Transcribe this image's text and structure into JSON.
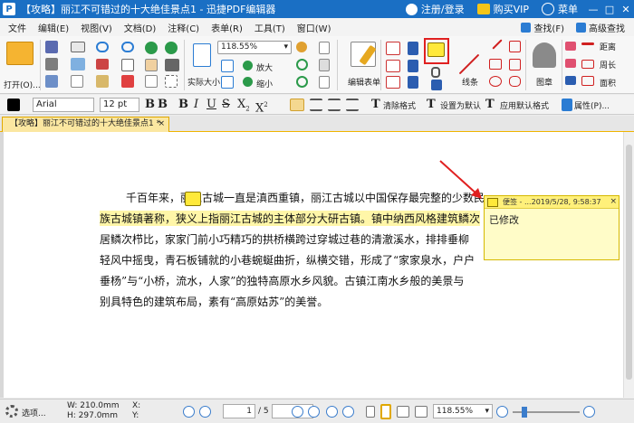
{
  "titlebar": {
    "title": "【攻略】丽江不可错过的十大绝佳景点1 - 迅捷PDF编辑器",
    "login": "注册/登录",
    "vip": "购买VIP",
    "menu": "菜单",
    "min": "—",
    "max": "□",
    "close": "✕"
  },
  "menubar": {
    "items": [
      "文件",
      "编辑(E)",
      "视图(V)",
      "文档(D)",
      "注释(C)",
      "表单(R)",
      "工具(T)",
      "窗口(W)"
    ],
    "find": "查找(F)",
    "advanced_search": "高级查找"
  },
  "ribbon": {
    "open": "打开(O)...",
    "actual_size": "实际大小",
    "zoom": "118.55%",
    "zoom_in": "放大",
    "zoom_out": "缩小",
    "edit_form": "编辑表单",
    "lines": "线条",
    "stamp": "图章",
    "distance": "距离",
    "perimeter": "周长",
    "area": "面积"
  },
  "format": {
    "font": "Arial",
    "size": "12 pt",
    "clear": "清除格式",
    "set_default": "设置为默认",
    "apply_default": "应用默认格式",
    "properties": "属性(P)..."
  },
  "tab": {
    "label": "【攻略】丽江不可错过的十大绝佳景点1 *",
    "close": "×"
  },
  "document": {
    "lines": [
      "千百年来，丽江古城一直是滇西重镇，丽江古城以中国保存最完整的少数民",
      "族古城镇著称，狭义上指丽江古城的主体部分大研古镇。镇中纳西风格建筑鳞次",
      "居鳞次栉比，家家门前小巧精巧的拱桥横跨过穿城过巷的清澈溪水，排排垂柳",
      "轻风中摇曳，青石板铺就的小巷蜿蜒曲折，纵横交错，形成了“家家泉水，户户",
      "垂杨”与“小桥，流水，人家”的独特高原水乡风貌。古镇江南水乡般的美景与",
      "别具特色的建筑布局，素有“高原姑苏”的美誉。"
    ]
  },
  "note": {
    "header": "便签 - ...2019/5/28, 9:58:37",
    "close": "×",
    "text": "已修改"
  },
  "status": {
    "options": "选项...",
    "width": "W: 210.0mm",
    "height": "H: 297.0mm",
    "x": "X:",
    "y": "Y:",
    "page_current": "1",
    "page_total": "/ 5",
    "zoom": "118.55%"
  }
}
